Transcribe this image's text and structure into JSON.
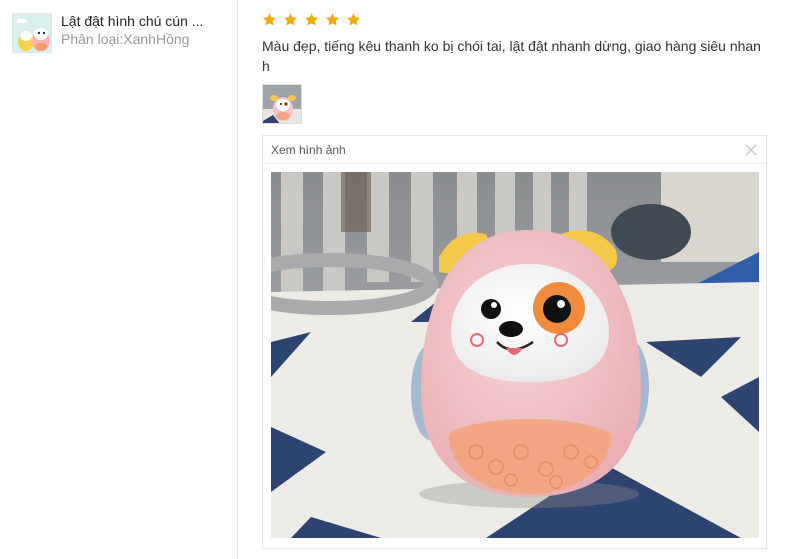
{
  "product": {
    "name": "Lật đật hình chú cún ...",
    "variant": "Phân loại:XanhHồng"
  },
  "review": {
    "rating": 5,
    "text": "Màu đẹp, tiếng kêu thanh ko bị chói tai, lật đật nhanh dừng, giao hàng siêu nhanh",
    "photo_count": 1
  },
  "viewer": {
    "title": "Xem hình ảnh",
    "close_icon": "close-icon"
  },
  "colors": {
    "star": "#f6a700",
    "toy_pink": "#f3c3c8",
    "toy_ears": "#f5c84a",
    "toy_belly": "#f2a684",
    "floor_navy": "#2e4470"
  }
}
